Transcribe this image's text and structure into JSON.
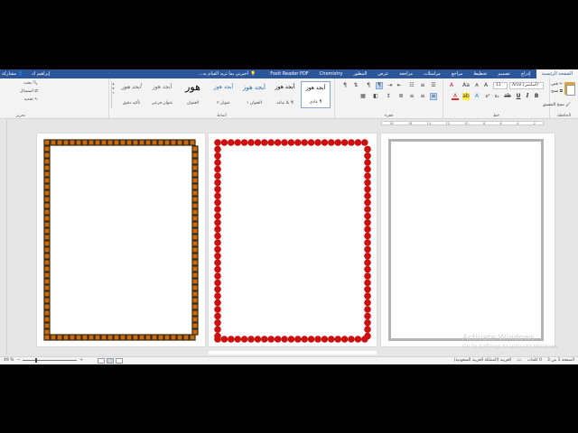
{
  "tabs": {
    "items": [
      {
        "label": "الصفحة الرئيسية",
        "active": true
      },
      {
        "label": "إدراج"
      },
      {
        "label": "تصميم"
      },
      {
        "label": "تخطيط"
      },
      {
        "label": "مراجع"
      },
      {
        "label": "مراسلات"
      },
      {
        "label": "مراجعة"
      },
      {
        "label": "عرض"
      },
      {
        "label": "المطور"
      },
      {
        "label": "Chemistry"
      },
      {
        "label": "Foxit Reader PDF"
      }
    ],
    "tell_me": "أخبرني بما تريد القيام به...",
    "user": "إبراهيم ك",
    "share": "مشاركة"
  },
  "clipboard": {
    "group_label": "الحافظة",
    "cut": "قص",
    "copy": "نسخ",
    "format_painter": "نسخ التنسيق"
  },
  "font": {
    "group_label": "خط",
    "name": "Arial (أساسي)",
    "size": "11",
    "bold": "B",
    "italic": "I",
    "underline": "U"
  },
  "paragraph": {
    "group_label": "فقرة"
  },
  "styles": {
    "group_label": "أنماط",
    "items": [
      {
        "preview": "أبجد هوز",
        "name": "¶ عادي",
        "selected": true
      },
      {
        "preview": "أبجد هوز",
        "name": "¶ بلا تباعد"
      },
      {
        "preview": "أبجد هوز",
        "name": "العنوان ١"
      },
      {
        "preview": "أبجد هوز",
        "name": "عنوان ٢"
      },
      {
        "preview": "هور",
        "name": "العنوان"
      },
      {
        "preview": "أبجد هوز",
        "name": "عنوان فرعي"
      },
      {
        "preview": "أبجد هوز",
        "name": "تأكيد دقيق"
      }
    ]
  },
  "editing": {
    "group_label": "تحرير",
    "find": "بحث",
    "replace": "استبدال",
    "select": "تحديد"
  },
  "ruler_ticks": [
    "18",
    "16",
    "14",
    "12",
    "10",
    "8",
    "6",
    "4",
    "2"
  ],
  "watermark": {
    "line1": "Activate Windows",
    "line2": "Go to Settings to activate Windows."
  },
  "status": {
    "page": "الصفحة 1 من 3",
    "words": "0 كلمات",
    "language": "العربية (المملكة العربية السعودية)",
    "zoom": "49 %",
    "zoom_level": 0.49
  },
  "colors": {
    "accent": "#2b579a",
    "frame1_outer": "#3a2a10",
    "frame1_inner": "#c86a10",
    "frame2": "#cc1010",
    "frame3": "#b3b3b3"
  }
}
